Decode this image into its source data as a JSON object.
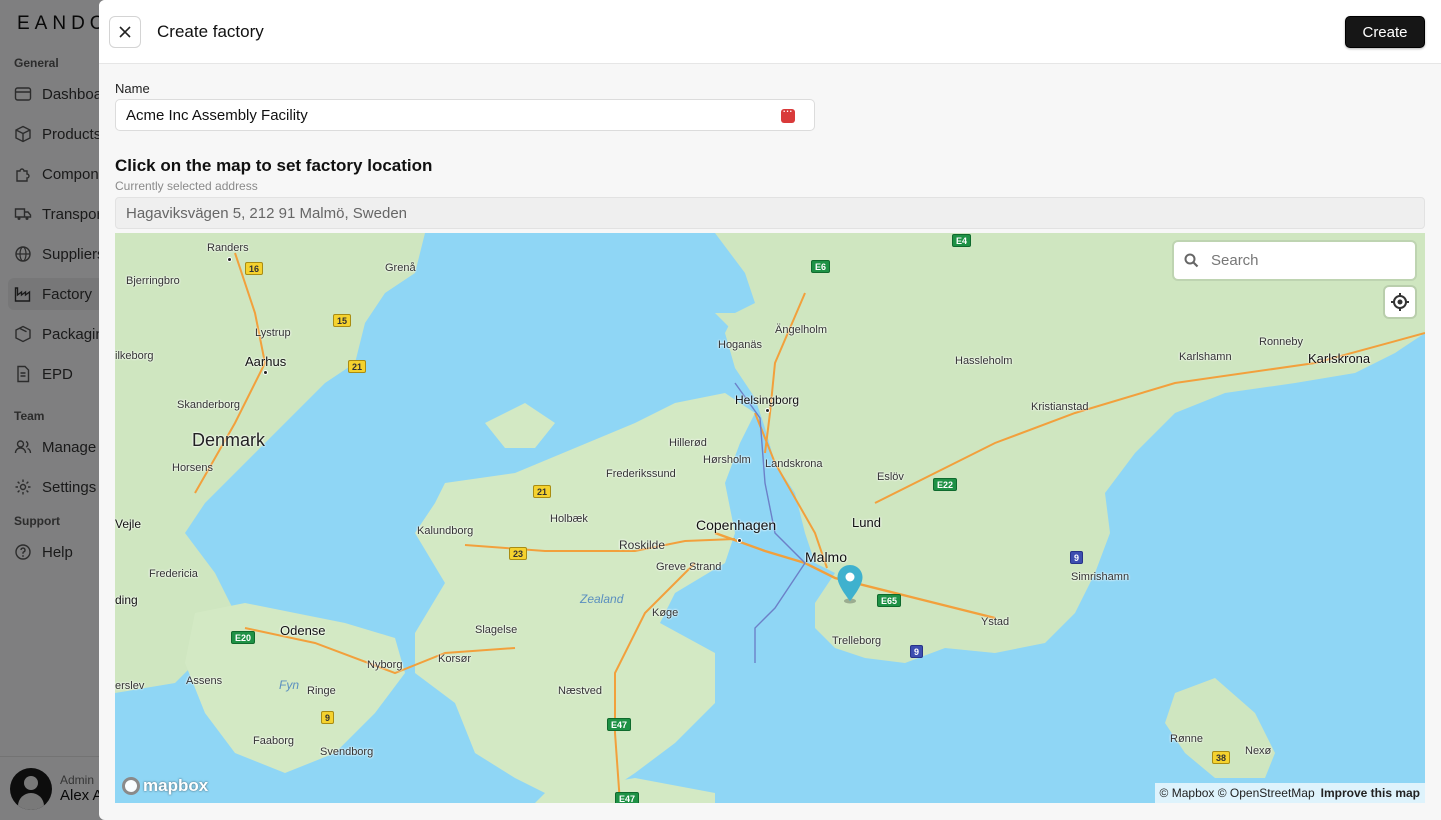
{
  "sidebar": {
    "logo": "EANDO",
    "sections": {
      "general": "General",
      "team": "Team",
      "support": "Support"
    },
    "items": [
      {
        "label": "Dashboard",
        "icon": "dashboard-icon"
      },
      {
        "label": "Products",
        "icon": "cube-icon"
      },
      {
        "label": "Components",
        "icon": "puzzle-icon"
      },
      {
        "label": "Transport",
        "icon": "truck-icon"
      },
      {
        "label": "Suppliers",
        "icon": "globe-icon"
      },
      {
        "label": "Factory",
        "icon": "factory-icon",
        "active": true
      },
      {
        "label": "Packaging",
        "icon": "package-icon"
      },
      {
        "label": "EPD",
        "icon": "document-icon"
      },
      {
        "label": "Manage",
        "icon": "users-icon"
      },
      {
        "label": "Settings",
        "icon": "gear-icon"
      },
      {
        "label": "Help",
        "icon": "help-icon"
      }
    ],
    "user": {
      "role": "Admin",
      "name": "Alex A"
    }
  },
  "drawer": {
    "title": "Create factory",
    "create_label": "Create",
    "name_label": "Name",
    "name_value": "Acme Inc Assembly Facility",
    "map_title": "Click on the map to set factory location",
    "address_label": "Currently selected address",
    "address_value": "Hagaviksvägen 5, 212 91 Malmö, Sweden"
  },
  "map": {
    "search_placeholder": "Search",
    "logo": "mapbox",
    "attribution": "© Mapbox © OpenStreetMap",
    "improve_link": "Improve this map",
    "labels": {
      "denmark": "Denmark",
      "copenhagen": "Copenhagen",
      "malmo": "Malmo",
      "zealand": "Zealand",
      "randers": "Randers",
      "grena": "Grenå",
      "bjerringbro": "Bjerringbro",
      "lystrup": "Lystrup",
      "aarhus": "Aarhus",
      "silkeborg": "ilkeborg",
      "skanderborg": "Skanderborg",
      "horsens": "Horsens",
      "vejle": "Vejle",
      "fredericia": "Fredericia",
      "kolding": "ding",
      "middelfart": "erslev",
      "odense": "Odense",
      "assens": "Assens",
      "fyn": "Fyn",
      "ringe": "Ringe",
      "nyborg": "Nyborg",
      "faaborg": "Faaborg",
      "svendborg": "Svendborg",
      "korsor": "Korsør",
      "slagelse": "Slagelse",
      "naestved": "Næstved",
      "kalundborg": "Kalundborg",
      "holbaek": "Holbæk",
      "roskilde": "Roskilde",
      "greve": "Greve Strand",
      "koge": "Køge",
      "hillerod": "Hillerød",
      "horsholm": "Hørsholm",
      "frederikssund": "Frederikssund",
      "hoganas": "Hoganäs",
      "angelholm": "Ängelholm",
      "helsingborg": "Helsingborg",
      "landskrona": "Landskrona",
      "eslov": "Eslöv",
      "lund": "Lund",
      "trelleborg": "Trelleborg",
      "ystad": "Ystad",
      "simrishamn": "Simrishamn",
      "hassleholm": "Hassleholm",
      "kristianstad": "Kristianstad",
      "karlshamn": "Karlshamn",
      "ronneby": "Ronneby",
      "karlskrona": "Karlskrona",
      "ronne": "Rønne",
      "nexo": "Nexø"
    },
    "roads": {
      "r16": "16",
      "r15": "15",
      "r21a": "21",
      "r21b": "21",
      "r23": "23",
      "e20": "E20",
      "r9a": "9",
      "e47a": "E47",
      "e47b": "E47",
      "e6": "E6",
      "e4": "E4",
      "e22": "E22",
      "e65": "E65",
      "r9b": "9",
      "r9c": "9",
      "r38": "38"
    }
  }
}
